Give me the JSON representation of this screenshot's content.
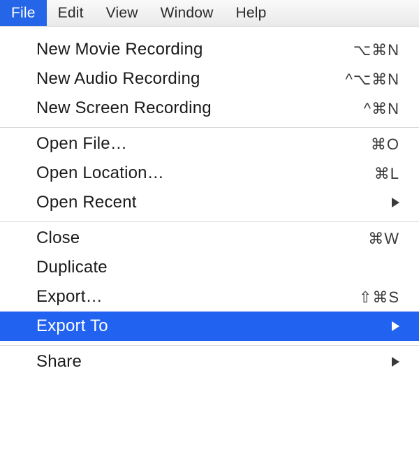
{
  "menubar": {
    "items": [
      {
        "label": "File",
        "selected": true
      },
      {
        "label": "Edit",
        "selected": false
      },
      {
        "label": "View",
        "selected": false
      },
      {
        "label": "Window",
        "selected": false
      },
      {
        "label": "Help",
        "selected": false
      }
    ]
  },
  "dropdown": {
    "sections": [
      {
        "items": [
          {
            "label": "New Movie Recording",
            "shortcut": "⌥⌘N",
            "submenu": false,
            "highlighted": false
          },
          {
            "label": "New Audio Recording",
            "shortcut": "^⌥⌘N",
            "submenu": false,
            "highlighted": false
          },
          {
            "label": "New Screen Recording",
            "shortcut": "^⌘N",
            "submenu": false,
            "highlighted": false
          }
        ]
      },
      {
        "items": [
          {
            "label": "Open File…",
            "shortcut": "⌘O",
            "submenu": false,
            "highlighted": false
          },
          {
            "label": "Open Location…",
            "shortcut": "⌘L",
            "submenu": false,
            "highlighted": false
          },
          {
            "label": "Open Recent",
            "shortcut": "",
            "submenu": true,
            "highlighted": false
          }
        ]
      },
      {
        "items": [
          {
            "label": "Close",
            "shortcut": "⌘W",
            "submenu": false,
            "highlighted": false
          },
          {
            "label": "Duplicate",
            "shortcut": "",
            "submenu": false,
            "highlighted": false
          },
          {
            "label": "Export…",
            "shortcut": "⇧⌘S",
            "submenu": false,
            "highlighted": false
          },
          {
            "label": "Export To",
            "shortcut": "",
            "submenu": true,
            "highlighted": true
          }
        ]
      },
      {
        "items": [
          {
            "label": "Share",
            "shortcut": "",
            "submenu": true,
            "highlighted": false
          }
        ]
      }
    ]
  }
}
